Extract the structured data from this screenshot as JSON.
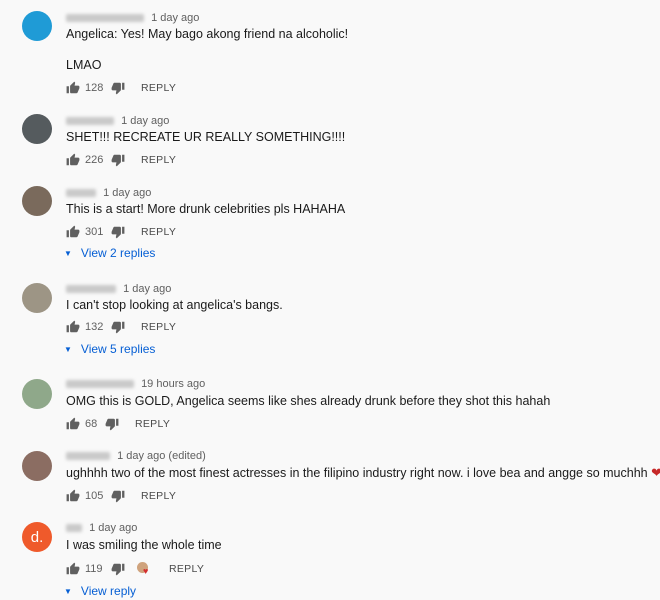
{
  "reply_label": "REPLY",
  "comments": [
    {
      "time": "1 day ago",
      "text": [
        "Angelica: Yes! May bago akong friend na alcoholic!",
        "LMAO"
      ],
      "likes": "128",
      "avatar": "#1f9bd6"
    },
    {
      "time": "1 day ago",
      "text": [
        "SHET!!! RECREATE UR REALLY SOMETHING!!!!"
      ],
      "likes": "226",
      "avatar": "#555b5e"
    },
    {
      "time": "1 day ago",
      "text": [
        "This is a start! More drunk celebrities pls HAHAHA"
      ],
      "likes": "301",
      "avatar": "#7a6a5c",
      "replies": "View 2 replies"
    },
    {
      "time": "1 day ago",
      "text": [
        "I can't stop looking at angelica's bangs."
      ],
      "likes": "132",
      "avatar": "#9d9585",
      "replies": "View 5 replies"
    },
    {
      "time": "19 hours ago",
      "text": [
        "OMG this is GOLD, Angelica seems like shes already drunk before they shot this  hahah"
      ],
      "likes": "68",
      "avatar": "#8fa88a"
    },
    {
      "time": "1 day ago (edited)",
      "text": [
        "ughhhh two of the most finest actresses in the filipino industry right now. i love bea and angge so muchhh"
      ],
      "text_emoji": "❤",
      "likes": "105",
      "avatar": "#8b6d62"
    },
    {
      "time": "1 day ago",
      "text": [
        "I was smiling the whole time"
      ],
      "likes": "119",
      "avatar": "#ef5a2b",
      "avatar_letter": "d.",
      "creator_heart": true,
      "replies": "View reply"
    }
  ]
}
